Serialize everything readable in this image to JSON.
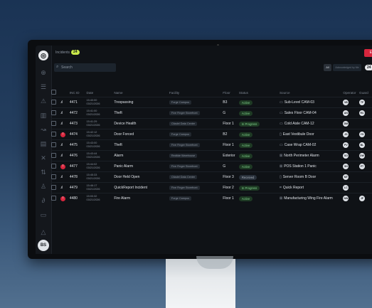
{
  "app": {
    "title": "Incidents",
    "incident_count": "24",
    "emergency_button": "Emergency ⌘",
    "search_placeholder": "Search",
    "ack_all": "All",
    "ack_by": "Acknowledged by Me",
    "right_count": "24",
    "user_initials": "BS"
  },
  "table": {
    "headers": [
      "INC ID",
      "Date",
      "Name",
      "Facility",
      "Floor",
      "Status",
      "Source",
      "Operator",
      "Guard"
    ],
    "rows": [
      {
        "id": "4471",
        "time": "15:40:00",
        "date": "03/21/2026",
        "name": "Trespassing",
        "facility": "Forge Campus",
        "floor": "B3",
        "status": "Active",
        "source": "Sub-Level CAM-03",
        "source_icon": "camera-icon",
        "operator": "VB",
        "guard": "TF",
        "signal": "bars",
        "critical": false
      },
      {
        "id": "4472",
        "time": "15:41:00",
        "date": "03/21/2026",
        "name": "Theft",
        "facility": "Five Finger Storefront",
        "floor": "G",
        "status": "Active",
        "source": "Sales Floor CAM-04",
        "source_icon": "camera-icon",
        "operator": "AN",
        "guard": "RC",
        "signal": "bars",
        "critical": false
      },
      {
        "id": "4473",
        "time": "15:41:29",
        "date": "03/21/2026",
        "name": "Device Health",
        "facility": "Citadel Data Center",
        "floor": "Floor 1",
        "status": "In Progress",
        "source": "Cold Aisle CAM-12",
        "source_icon": "camera-icon",
        "operator": "DM",
        "guard": "",
        "signal": "bars",
        "critical": false
      },
      {
        "id": "4474",
        "time": "15:42:12",
        "date": "03/21/2026",
        "name": "Door Forced",
        "facility": "Forge Campus",
        "floor": "B2",
        "status": "Active",
        "source": "East Vestibule Door",
        "source_icon": "door-icon",
        "operator": "JS",
        "guard": "YS",
        "signal": "critical",
        "critical": true
      },
      {
        "id": "4475",
        "time": "15:43:00",
        "date": "03/21/2026",
        "name": "Theft",
        "facility": "Five Finger Storefront",
        "floor": "Floor 1",
        "status": "Active",
        "source": "Case Wrap CAM-02",
        "source_icon": "camera-icon",
        "operator": "PV",
        "guard": "BL",
        "signal": "bars",
        "critical": false
      },
      {
        "id": "4476",
        "time": "15:43:44",
        "date": "03/21/2026",
        "name": "Alarm",
        "facility": "Redtide Warehouse",
        "floor": "Exterior",
        "status": "Active",
        "source": "North Perimeter Alarm",
        "source_icon": "alarm-icon",
        "operator": "SO",
        "guard": "DW",
        "signal": "bars",
        "critical": false
      },
      {
        "id": "4477",
        "time": "15:44:02",
        "date": "03/21/2026",
        "name": "Panic Alarm",
        "facility": "Five Finger Storefront",
        "floor": "G",
        "status": "Active",
        "source": "POS Station 1 Panic",
        "source_icon": "alarm-icon",
        "operator": "SH",
        "guard": "FT",
        "signal": "critical",
        "critical": true
      },
      {
        "id": "4478",
        "time": "15:45:33",
        "date": "03/21/2026",
        "name": "Door Held Open",
        "facility": "Citadel Data Center",
        "floor": "Floor 3",
        "status": "Received",
        "source": "Server Room B Door",
        "source_icon": "door-icon",
        "operator": "MT",
        "guard": "",
        "signal": "bars",
        "critical": false
      },
      {
        "id": "4479",
        "time": "15:46:17",
        "date": "03/21/2026",
        "name": "QuickReport Incident",
        "facility": "Five Finger Storefront",
        "floor": "Floor 2",
        "status": "In Progress",
        "source": "Quick Report",
        "source_icon": "report-icon",
        "operator": "LC",
        "guard": "",
        "signal": "bars",
        "critical": false
      },
      {
        "id": "4480",
        "time": "15:00:32",
        "date": "03/21/2026",
        "name": "Fire Alarm",
        "facility": "Forge Campus",
        "floor": "Floor 1",
        "status": "Active",
        "source": "Manufacturing Wing Fire Alarm",
        "source_icon": "alarm-icon",
        "operator": "NW",
        "guard": "JF",
        "signal": "critical",
        "critical": true
      }
    ]
  },
  "colors": {
    "accent": "#c8e84a",
    "emergency": "#d7263d",
    "active": "#7fd08a",
    "background": "#0f1216"
  }
}
